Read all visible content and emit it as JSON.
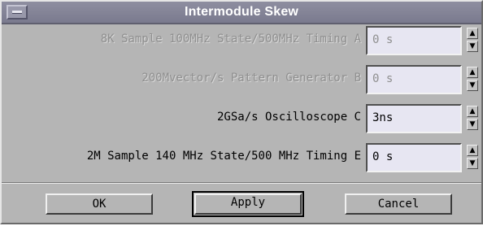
{
  "window": {
    "title": "Intermodule Skew"
  },
  "rows": [
    {
      "label": "8K Sample 100MHz State/500MHz Timing A",
      "value": "0 s",
      "enabled": false
    },
    {
      "label": "200Mvector/s Pattern Generator B",
      "value": "0 s",
      "enabled": false
    },
    {
      "label": "2GSa/s Oscilloscope C",
      "value": "3ns",
      "enabled": true
    },
    {
      "label": "2M Sample  140 MHz State/500 MHz Timing E",
      "value": "0 s",
      "enabled": true
    }
  ],
  "spinner": {
    "up_icon": "arrow-up-icon",
    "down_icon": "arrow-down-icon",
    "up_glyph": "▲",
    "down_glyph": "▼"
  },
  "buttons": {
    "ok": "OK",
    "apply": "Apply",
    "cancel": "Cancel"
  },
  "colors": {
    "dialog_bg": "#b5b5b5",
    "titlebar_bg": "#7f7f93",
    "field_bg": "#e7e6f2",
    "disabled_text": "#8f8f8f"
  }
}
